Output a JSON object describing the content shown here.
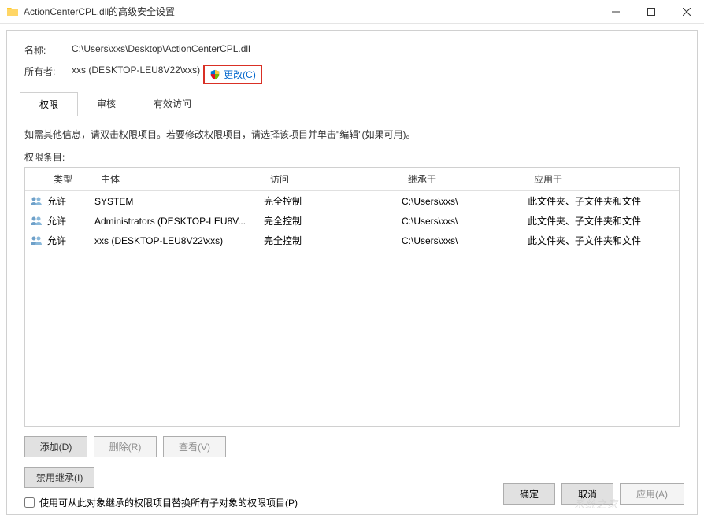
{
  "window": {
    "title": "ActionCenterCPL.dll的高级安全设置"
  },
  "info": {
    "name_label": "名称:",
    "name_value": "C:\\Users\\xxs\\Desktop\\ActionCenterCPL.dll",
    "owner_label": "所有者:",
    "owner_value": "xxs (DESKTOP-LEU8V22\\xxs)",
    "change_label": "更改(C)"
  },
  "tabs": {
    "permissions": "权限",
    "auditing": "审核",
    "effective": "有效访问"
  },
  "instruction": "如需其他信息，请双击权限项目。若要修改权限项目，请选择该项目并单击\"编辑\"(如果可用)。",
  "entries_label": "权限条目:",
  "columns": {
    "type": "类型",
    "principal": "主体",
    "access": "访问",
    "inherited": "继承于",
    "applies": "应用于"
  },
  "rows": [
    {
      "type": "允许",
      "principal": "SYSTEM",
      "access": "完全控制",
      "inherited": "C:\\Users\\xxs\\",
      "applies": "此文件夹、子文件夹和文件"
    },
    {
      "type": "允许",
      "principal": "Administrators (DESKTOP-LEU8V...",
      "access": "完全控制",
      "inherited": "C:\\Users\\xxs\\",
      "applies": "此文件夹、子文件夹和文件"
    },
    {
      "type": "允许",
      "principal": "xxs (DESKTOP-LEU8V22\\xxs)",
      "access": "完全控制",
      "inherited": "C:\\Users\\xxs\\",
      "applies": "此文件夹、子文件夹和文件"
    }
  ],
  "buttons": {
    "add": "添加(D)",
    "remove": "删除(R)",
    "view": "查看(V)",
    "disable_inherit": "禁用继承(I)",
    "replace_checkbox": "使用可从此对象继承的权限项目替换所有子对象的权限项目(P)",
    "ok": "确定",
    "cancel": "取消",
    "apply": "应用(A)"
  },
  "watermark": "系统之家"
}
